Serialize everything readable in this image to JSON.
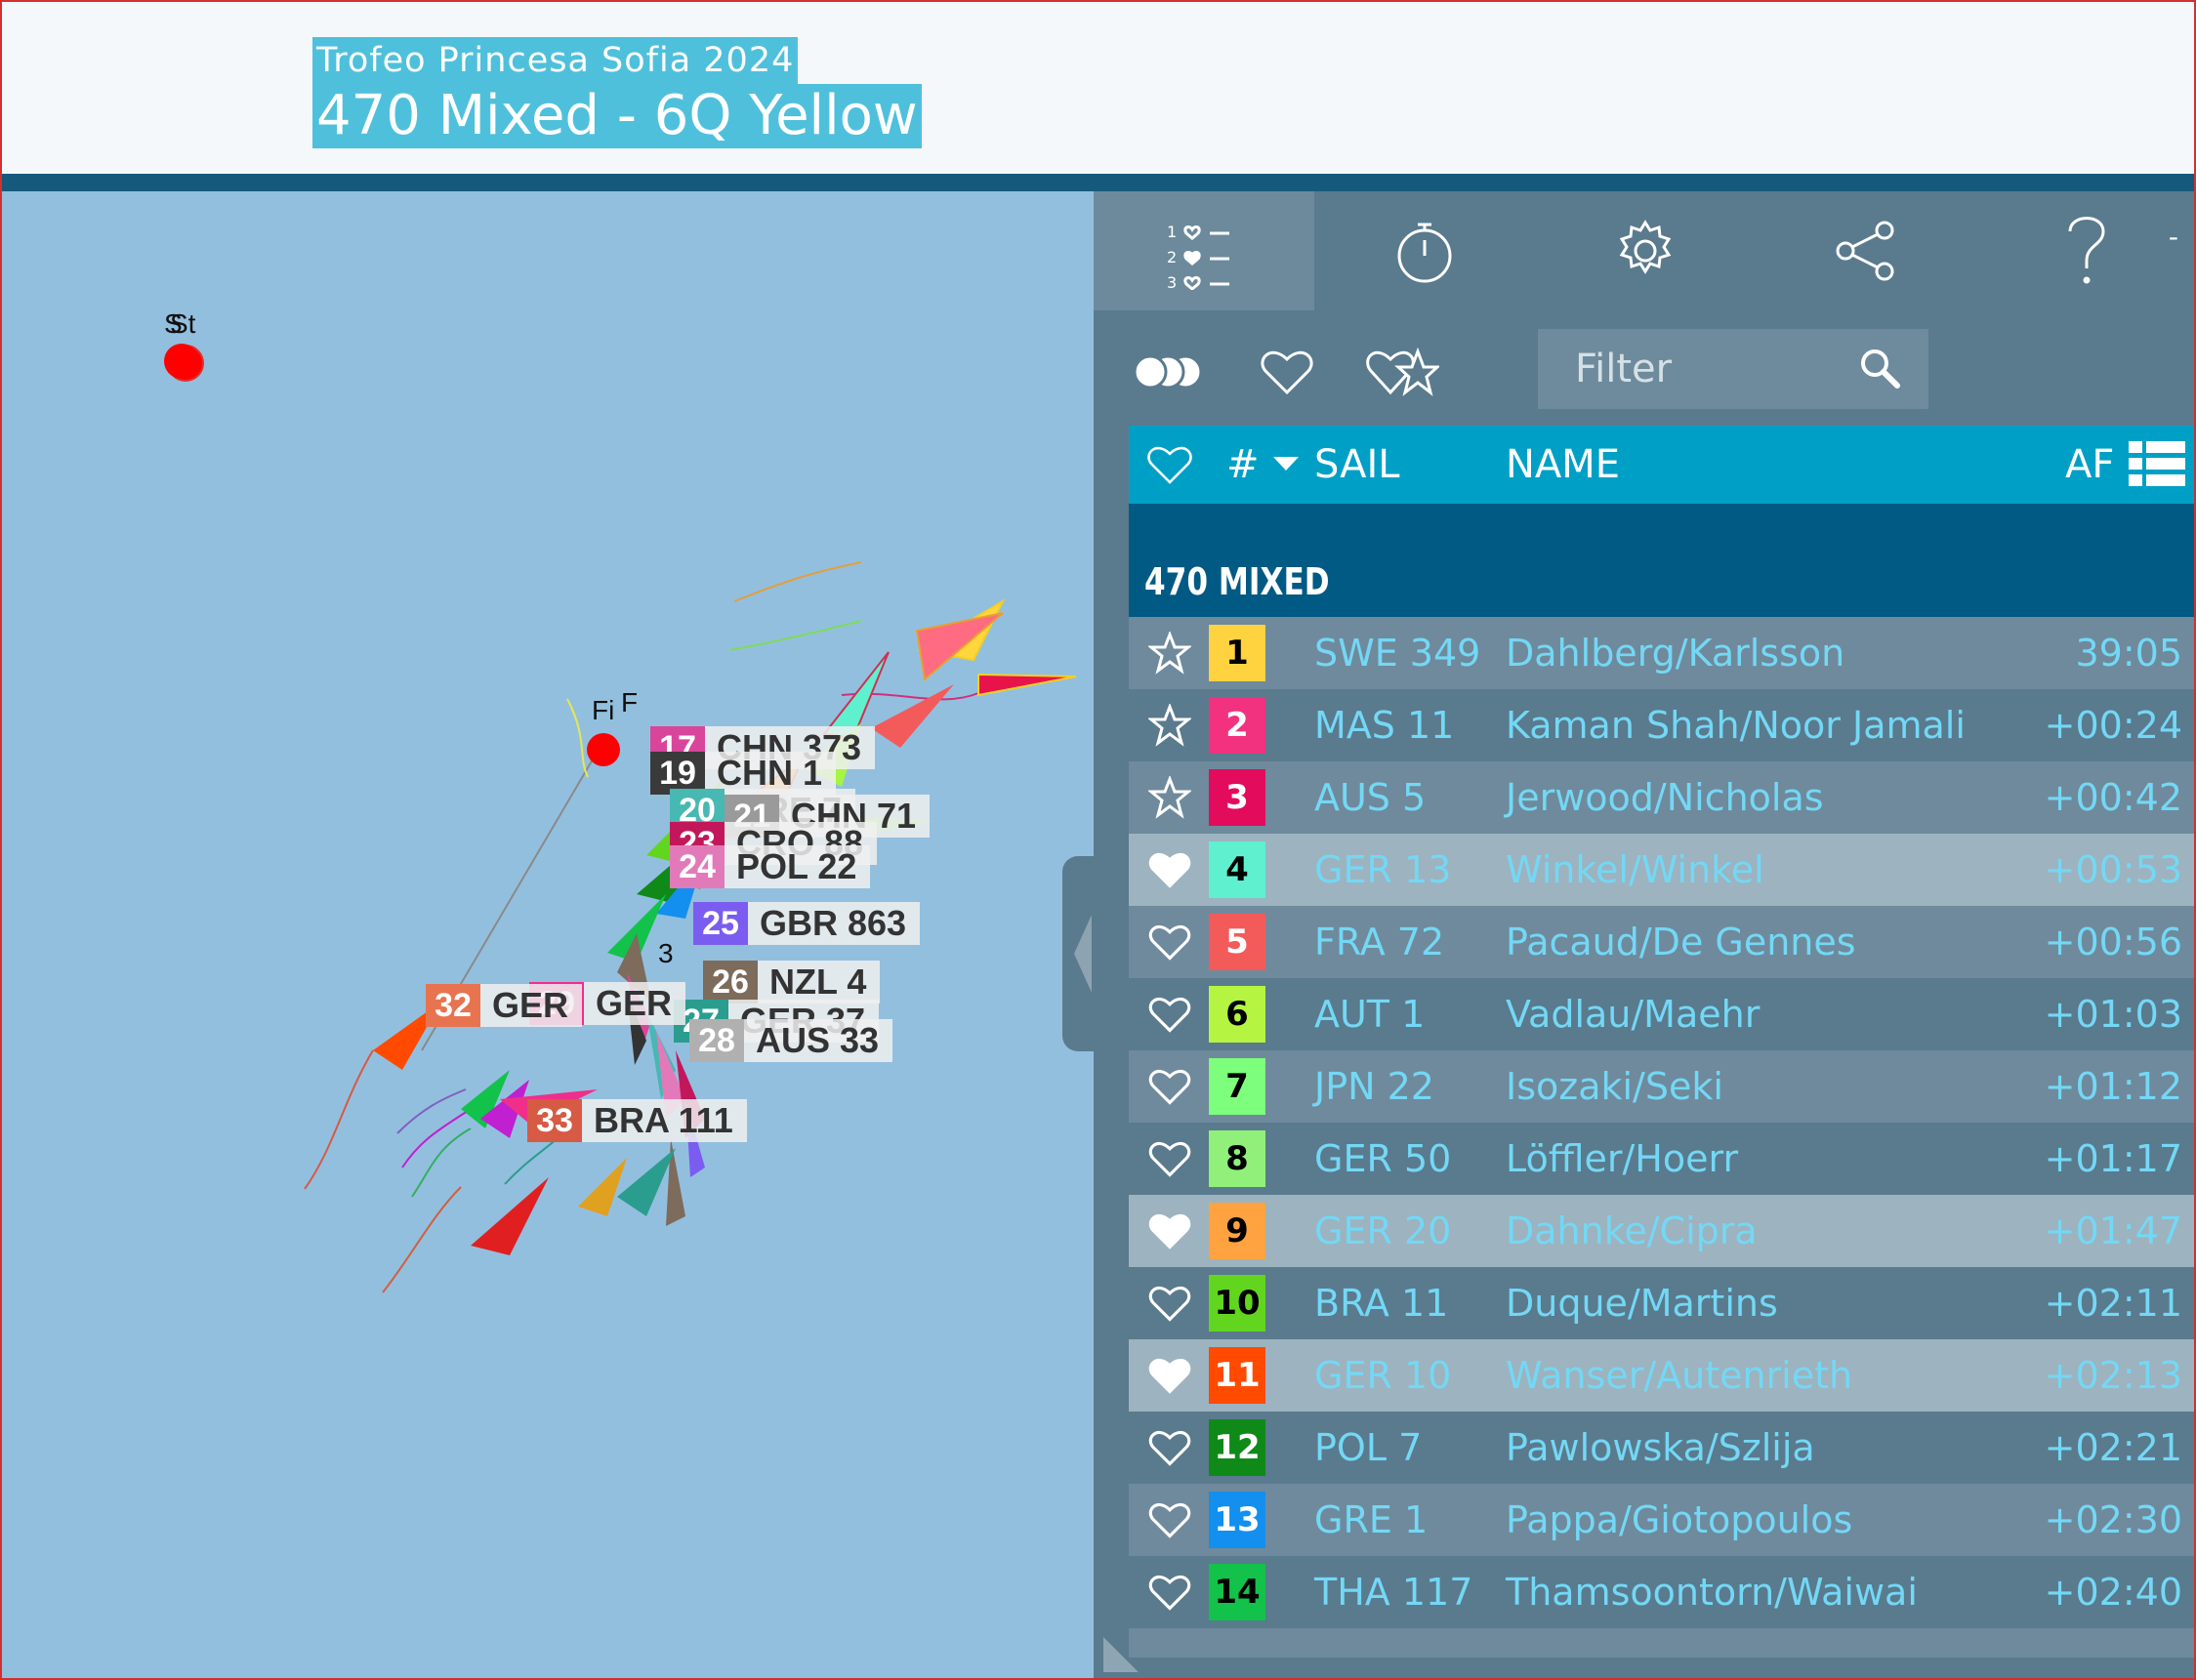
{
  "header": {
    "event_title": "Trofeo Princesa Sofia 2024",
    "race_title": "470 Mixed - 6Q Yellow"
  },
  "map": {
    "marks": {
      "start_label": "St",
      "start_label_2": "S",
      "finish_label": "Fi",
      "finish_label_2": "F",
      "mark3_label": "3"
    },
    "boat_labels": [
      {
        "num": "17",
        "sail": "CHN 373",
        "color": "#d9459b"
      },
      {
        "num": "19",
        "sail": "CHN 1",
        "color": "#3a3a3a"
      },
      {
        "num": "20",
        "sail": "GRE 7",
        "color": "#47b8b2"
      },
      {
        "num": "21",
        "sail": "CHN 71",
        "color": "#9a9a9a"
      },
      {
        "num": "23",
        "sail": "CRO 88",
        "color": "#c2185b"
      },
      {
        "num": "24",
        "sail": "POL 22",
        "color": "#e27ab9"
      },
      {
        "num": "25",
        "sail": "GBR 863",
        "color": "#7b5cf0"
      },
      {
        "num": "26",
        "sail": "NZL 4",
        "color": "#7d6b5b"
      },
      {
        "num": "27",
        "sail": "GER 37",
        "color": "#2a9d8f"
      },
      {
        "num": "28",
        "sail": "AUS 33",
        "color": "#b0b0b0"
      },
      {
        "num": "29",
        "sail": "GER",
        "color": "#ef2f8a"
      },
      {
        "num": "32",
        "sail": "GER",
        "color": "#e8744f"
      },
      {
        "num": "33",
        "sail": "BRA 111",
        "color": "#d65a44"
      }
    ]
  },
  "toolbar": {
    "items": [
      {
        "icon": "leaderboard-icon"
      },
      {
        "icon": "stopwatch-icon"
      },
      {
        "icon": "gear-icon"
      },
      {
        "icon": "share-icon"
      },
      {
        "icon": "help-icon"
      }
    ],
    "minimize": "-"
  },
  "filter": {
    "placeholder": "Filter",
    "buttons": [
      "all-boats-icon",
      "favorites-icon",
      "favorites-star-icon"
    ]
  },
  "table": {
    "headers": {
      "fav": "heart-icon",
      "rank": "#",
      "sail": "SAIL",
      "name": "NAME",
      "time": "AF"
    },
    "group": "470 MIXED",
    "rows": [
      {
        "fav": "star",
        "rank": "1",
        "rank_color": "#ffd23f",
        "rank_text_color": "#000000",
        "sail": "SWE 349",
        "name": "Dahlberg/Karlsson",
        "time": "39:05"
      },
      {
        "fav": "star",
        "rank": "2",
        "rank_color": "#f2317f",
        "rank_text_color": "#ffffff",
        "sail": "MAS 11",
        "name": "Kaman Shah/Noor Jamali",
        "time": "+00:24"
      },
      {
        "fav": "star",
        "rank": "3",
        "rank_color": "#e30b5c",
        "rank_text_color": "#ffffff",
        "sail": "AUS 5",
        "name": "Jerwood/Nicholas",
        "time": "+00:42"
      },
      {
        "fav": "heart-filled",
        "rank": "4",
        "rank_color": "#5ff0d0",
        "rank_text_color": "#000000",
        "sail": "GER 13",
        "name": "Winkel/Winkel",
        "time": "+00:53"
      },
      {
        "fav": "heart",
        "rank": "5",
        "rank_color": "#f35b5b",
        "rank_text_color": "#ffffff",
        "sail": "FRA 72",
        "name": "Pacaud/De Gennes",
        "time": "+00:56"
      },
      {
        "fav": "heart",
        "rank": "6",
        "rank_color": "#b5f542",
        "rank_text_color": "#000000",
        "sail": "AUT 1",
        "name": "Vadlau/Maehr",
        "time": "+01:03"
      },
      {
        "fav": "heart",
        "rank": "7",
        "rank_color": "#7dff7d",
        "rank_text_color": "#000000",
        "sail": "JPN 22",
        "name": "Isozaki/Seki",
        "time": "+01:12"
      },
      {
        "fav": "heart",
        "rank": "8",
        "rank_color": "#90f07a",
        "rank_text_color": "#000000",
        "sail": "GER 50",
        "name": "Löffler/Hoerr",
        "time": "+01:17"
      },
      {
        "fav": "heart-filled",
        "rank": "9",
        "rank_color": "#ffa340",
        "rank_text_color": "#000000",
        "sail": "GER 20",
        "name": "Dahnke/Cipra",
        "time": "+01:47"
      },
      {
        "fav": "heart",
        "rank": "10",
        "rank_color": "#62d61f",
        "rank_text_color": "#000000",
        "sail": "BRA 11",
        "name": "Duque/Martins",
        "time": "+02:11"
      },
      {
        "fav": "heart-filled",
        "rank": "11",
        "rank_color": "#ff4a00",
        "rank_text_color": "#ffffff",
        "sail": "GER 10",
        "name": "Wanser/Autenrieth",
        "time": "+02:13"
      },
      {
        "fav": "heart",
        "rank": "12",
        "rank_color": "#0f8a19",
        "rank_text_color": "#ffffff",
        "sail": "POL 7",
        "name": "Pawlowska/Szlija",
        "time": "+02:21"
      },
      {
        "fav": "heart",
        "rank": "13",
        "rank_color": "#138ff0",
        "rank_text_color": "#ffffff",
        "sail": "GRE 1",
        "name": "Pappa/Giotopoulos",
        "time": "+02:30"
      },
      {
        "fav": "heart",
        "rank": "14",
        "rank_color": "#12c24a",
        "rank_text_color": "#000000",
        "sail": "THA 117",
        "name": "Thamsoontorn/Waiwai",
        "time": "+02:40"
      }
    ]
  }
}
